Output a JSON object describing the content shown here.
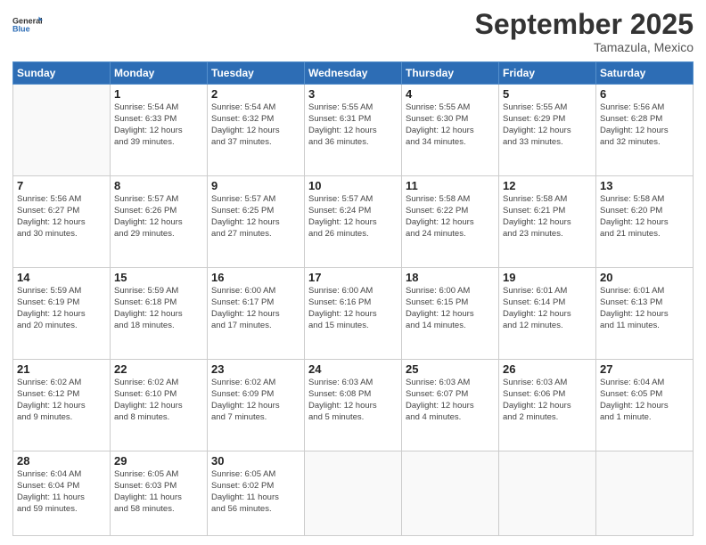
{
  "logo": {
    "line1": "General",
    "line2": "Blue"
  },
  "header": {
    "month": "September 2025",
    "location": "Tamazula, Mexico"
  },
  "weekdays": [
    "Sunday",
    "Monday",
    "Tuesday",
    "Wednesday",
    "Thursday",
    "Friday",
    "Saturday"
  ],
  "weeks": [
    [
      {
        "day": "",
        "info": ""
      },
      {
        "day": "1",
        "info": "Sunrise: 5:54 AM\nSunset: 6:33 PM\nDaylight: 12 hours\nand 39 minutes."
      },
      {
        "day": "2",
        "info": "Sunrise: 5:54 AM\nSunset: 6:32 PM\nDaylight: 12 hours\nand 37 minutes."
      },
      {
        "day": "3",
        "info": "Sunrise: 5:55 AM\nSunset: 6:31 PM\nDaylight: 12 hours\nand 36 minutes."
      },
      {
        "day": "4",
        "info": "Sunrise: 5:55 AM\nSunset: 6:30 PM\nDaylight: 12 hours\nand 34 minutes."
      },
      {
        "day": "5",
        "info": "Sunrise: 5:55 AM\nSunset: 6:29 PM\nDaylight: 12 hours\nand 33 minutes."
      },
      {
        "day": "6",
        "info": "Sunrise: 5:56 AM\nSunset: 6:28 PM\nDaylight: 12 hours\nand 32 minutes."
      }
    ],
    [
      {
        "day": "7",
        "info": "Sunrise: 5:56 AM\nSunset: 6:27 PM\nDaylight: 12 hours\nand 30 minutes."
      },
      {
        "day": "8",
        "info": "Sunrise: 5:57 AM\nSunset: 6:26 PM\nDaylight: 12 hours\nand 29 minutes."
      },
      {
        "day": "9",
        "info": "Sunrise: 5:57 AM\nSunset: 6:25 PM\nDaylight: 12 hours\nand 27 minutes."
      },
      {
        "day": "10",
        "info": "Sunrise: 5:57 AM\nSunset: 6:24 PM\nDaylight: 12 hours\nand 26 minutes."
      },
      {
        "day": "11",
        "info": "Sunrise: 5:58 AM\nSunset: 6:22 PM\nDaylight: 12 hours\nand 24 minutes."
      },
      {
        "day": "12",
        "info": "Sunrise: 5:58 AM\nSunset: 6:21 PM\nDaylight: 12 hours\nand 23 minutes."
      },
      {
        "day": "13",
        "info": "Sunrise: 5:58 AM\nSunset: 6:20 PM\nDaylight: 12 hours\nand 21 minutes."
      }
    ],
    [
      {
        "day": "14",
        "info": "Sunrise: 5:59 AM\nSunset: 6:19 PM\nDaylight: 12 hours\nand 20 minutes."
      },
      {
        "day": "15",
        "info": "Sunrise: 5:59 AM\nSunset: 6:18 PM\nDaylight: 12 hours\nand 18 minutes."
      },
      {
        "day": "16",
        "info": "Sunrise: 6:00 AM\nSunset: 6:17 PM\nDaylight: 12 hours\nand 17 minutes."
      },
      {
        "day": "17",
        "info": "Sunrise: 6:00 AM\nSunset: 6:16 PM\nDaylight: 12 hours\nand 15 minutes."
      },
      {
        "day": "18",
        "info": "Sunrise: 6:00 AM\nSunset: 6:15 PM\nDaylight: 12 hours\nand 14 minutes."
      },
      {
        "day": "19",
        "info": "Sunrise: 6:01 AM\nSunset: 6:14 PM\nDaylight: 12 hours\nand 12 minutes."
      },
      {
        "day": "20",
        "info": "Sunrise: 6:01 AM\nSunset: 6:13 PM\nDaylight: 12 hours\nand 11 minutes."
      }
    ],
    [
      {
        "day": "21",
        "info": "Sunrise: 6:02 AM\nSunset: 6:12 PM\nDaylight: 12 hours\nand 9 minutes."
      },
      {
        "day": "22",
        "info": "Sunrise: 6:02 AM\nSunset: 6:10 PM\nDaylight: 12 hours\nand 8 minutes."
      },
      {
        "day": "23",
        "info": "Sunrise: 6:02 AM\nSunset: 6:09 PM\nDaylight: 12 hours\nand 7 minutes."
      },
      {
        "day": "24",
        "info": "Sunrise: 6:03 AM\nSunset: 6:08 PM\nDaylight: 12 hours\nand 5 minutes."
      },
      {
        "day": "25",
        "info": "Sunrise: 6:03 AM\nSunset: 6:07 PM\nDaylight: 12 hours\nand 4 minutes."
      },
      {
        "day": "26",
        "info": "Sunrise: 6:03 AM\nSunset: 6:06 PM\nDaylight: 12 hours\nand 2 minutes."
      },
      {
        "day": "27",
        "info": "Sunrise: 6:04 AM\nSunset: 6:05 PM\nDaylight: 12 hours\nand 1 minute."
      }
    ],
    [
      {
        "day": "28",
        "info": "Sunrise: 6:04 AM\nSunset: 6:04 PM\nDaylight: 11 hours\nand 59 minutes."
      },
      {
        "day": "29",
        "info": "Sunrise: 6:05 AM\nSunset: 6:03 PM\nDaylight: 11 hours\nand 58 minutes."
      },
      {
        "day": "30",
        "info": "Sunrise: 6:05 AM\nSunset: 6:02 PM\nDaylight: 11 hours\nand 56 minutes."
      },
      {
        "day": "",
        "info": ""
      },
      {
        "day": "",
        "info": ""
      },
      {
        "day": "",
        "info": ""
      },
      {
        "day": "",
        "info": ""
      }
    ]
  ]
}
